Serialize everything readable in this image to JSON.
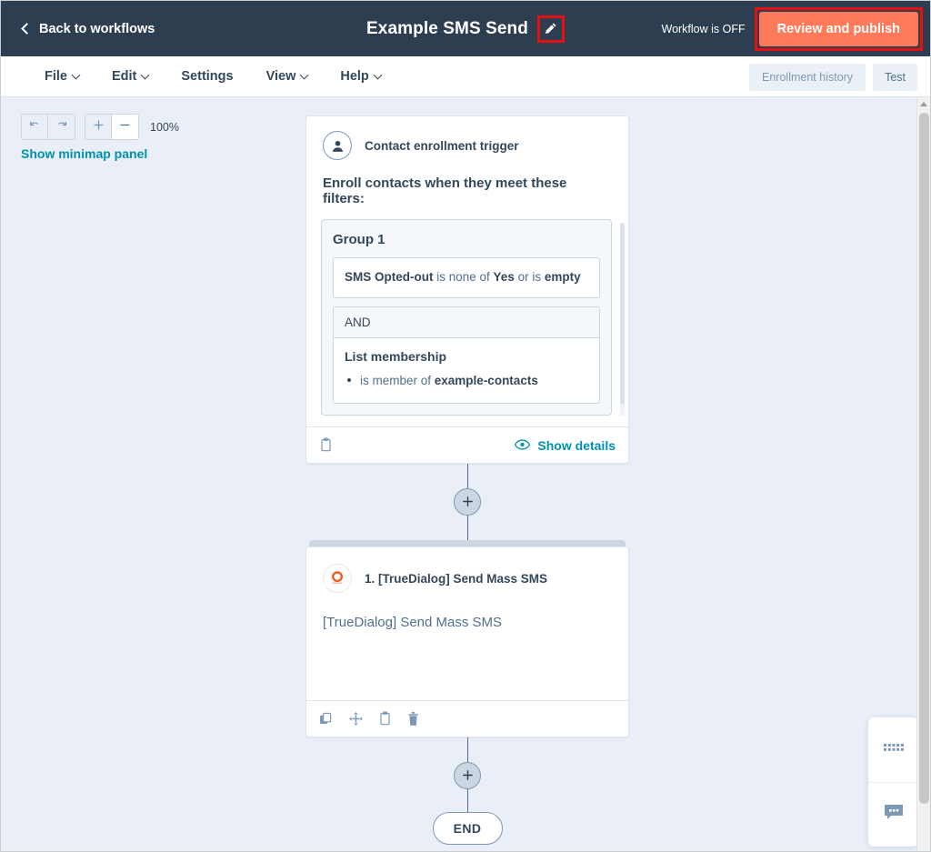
{
  "topbar": {
    "back_label": "Back to workflows",
    "back_icon": "chevron-left-icon",
    "workflow_title": "Example SMS Send",
    "edit_icon": "pencil-icon",
    "status_text": "Workflow is OFF",
    "publish_label": "Review and publish",
    "publish_color": "#ff7a59",
    "highlight_color": "#e8100f",
    "bar_color": "#2d3e50"
  },
  "menubar": {
    "items": [
      {
        "label": "File",
        "has_caret": true
      },
      {
        "label": "Edit",
        "has_caret": true
      },
      {
        "label": "Settings",
        "has_caret": false
      },
      {
        "label": "View",
        "has_caret": true
      },
      {
        "label": "Help",
        "has_caret": true
      }
    ],
    "enrollment_history_label": "Enrollment history",
    "test_label": "Test"
  },
  "canvas": {
    "background": "#eaeef7",
    "toolbar": {
      "undo_icon": "undo-icon",
      "redo_icon": "redo-icon",
      "zoom_in_label": "+",
      "zoom_out_label": "—",
      "zoom_level": "100%"
    },
    "minimap_link": "Show minimap panel",
    "minimap_link_color": "#0091ae"
  },
  "trigger_card": {
    "icon": "contact-avatar-icon",
    "header_label": "Contact enrollment trigger",
    "subheading": "Enroll contacts when they meet these filters:",
    "group": {
      "title": "Group 1",
      "filters": [
        {
          "type": "property-filter",
          "parts": [
            {
              "text": "SMS Opted-out",
              "bold": true
            },
            {
              "text": " is none of ",
              "bold": false
            },
            {
              "text": "Yes",
              "bold": true
            },
            {
              "text": " or is ",
              "bold": false
            },
            {
              "text": "empty",
              "bold": true
            }
          ]
        }
      ],
      "operator": "AND",
      "second_filter": {
        "title": "List membership",
        "items": [
          {
            "parts": [
              {
                "text": "is member of ",
                "bold": false
              },
              {
                "text": "example-contacts",
                "bold": true
              }
            ]
          }
        ]
      }
    },
    "footer": {
      "clipboard_icon": "clipboard-icon",
      "eye_icon": "eye-icon",
      "show_details_label": "Show details"
    }
  },
  "connectors": {
    "plus_label": "+",
    "plus_icon": "plus-circle-icon"
  },
  "action_card": {
    "icon": "truedialog-logo-icon",
    "icon_color": "#f5571f",
    "step_title": "1. [TrueDialog] Send Mass SMS",
    "body_text": "[TrueDialog] Send Mass SMS",
    "footer_icons": [
      "duplicate-icon",
      "move-icon",
      "clipboard-icon",
      "trash-icon"
    ]
  },
  "end_node": {
    "label": "END"
  },
  "float_widget": {
    "items": [
      {
        "icon": "grid-dots-icon"
      },
      {
        "icon": "chat-bubble-icon"
      }
    ]
  },
  "scrollbar": {
    "up_icon": "scroll-up-arrow-icon",
    "down_icon": "scroll-down-arrow-icon"
  }
}
